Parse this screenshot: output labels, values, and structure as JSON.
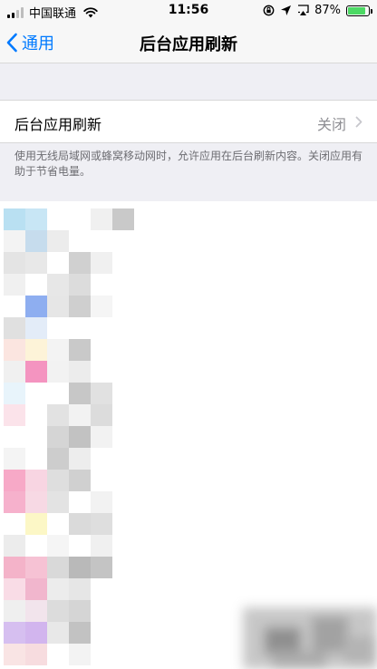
{
  "status_bar": {
    "carrier": "中国联通",
    "time": "11:56",
    "battery_percent": "87%",
    "battery_level": 0.87,
    "icons": [
      "signal-icon",
      "wifi-icon",
      "rotation-lock-icon",
      "location-icon",
      "airplay-icon",
      "battery-icon"
    ]
  },
  "nav": {
    "back_label": "通用",
    "title": "后台应用刷新"
  },
  "setting": {
    "label": "后台应用刷新",
    "value": "关闭"
  },
  "footer_note": "使用无线局域网或蜂窝移动网时，允许应用在后台刷新内容。关闭应用有助于节省电量。",
  "colors": {
    "accent": "#007aff",
    "background": "#efeff4",
    "secondary_text": "#8e8e93",
    "battery": "#4cd964"
  }
}
